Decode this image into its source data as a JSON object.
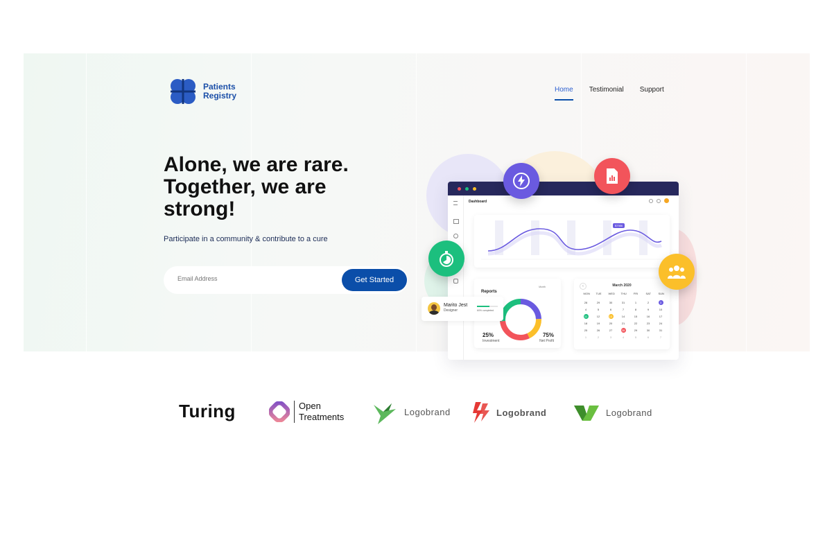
{
  "brand": {
    "line1": "Patients",
    "line2": "Registry"
  },
  "nav": [
    {
      "label": "Home",
      "active": true
    },
    {
      "label": "Testimonial",
      "active": false
    },
    {
      "label": "Support",
      "active": false
    }
  ],
  "hero": {
    "headline_lines": [
      "Alone, we are rare.",
      "Together, we are",
      "strong!"
    ],
    "subtitle": "Participate in a community & contribute to a cure",
    "email_placeholder": "Email Address",
    "cta_label": "Get Started"
  },
  "dashboard": {
    "title": "Dashboard",
    "chart_badge": "$7986",
    "reports": {
      "title": "Reports",
      "filter": "Month",
      "left_pct": "25%",
      "left_label": "Investment",
      "right_pct": "75%",
      "right_label": "Net Profit"
    },
    "profile": {
      "name": "Marito Jest",
      "role": "Designer",
      "progress_label": "60% completed"
    },
    "calendar": {
      "month": "March 2020",
      "weekdays": [
        "MON",
        "TUE",
        "WED",
        "THU",
        "FRI",
        "SAT",
        "SUN"
      ],
      "rows": [
        [
          "28",
          "29",
          "30",
          "31",
          "1",
          "2",
          "3"
        ],
        [
          "4",
          "5",
          "6",
          "7",
          "8",
          "9",
          "10"
        ],
        [
          "11",
          "12",
          "13",
          "14",
          "15",
          "16",
          "17"
        ],
        [
          "18",
          "19",
          "20",
          "21",
          "22",
          "23",
          "24"
        ],
        [
          "25",
          "26",
          "27",
          "28",
          "29",
          "30",
          "31"
        ],
        [
          "1",
          "2",
          "3",
          "4",
          "5",
          "6",
          "7"
        ]
      ]
    }
  },
  "logos": [
    {
      "text": "Turing"
    },
    {
      "line1": "Open",
      "line2": "Treatments"
    },
    {
      "text": "Logobrand"
    },
    {
      "text": "Logobrand"
    },
    {
      "text": "Logobrand"
    }
  ],
  "colors": {
    "primary": "#0b4ea9",
    "nav_active": "#2c5fd0",
    "purple": "#6a5ae0",
    "green": "#1cbf7e",
    "red": "#f2545b",
    "yellow": "#fbbf2a"
  }
}
